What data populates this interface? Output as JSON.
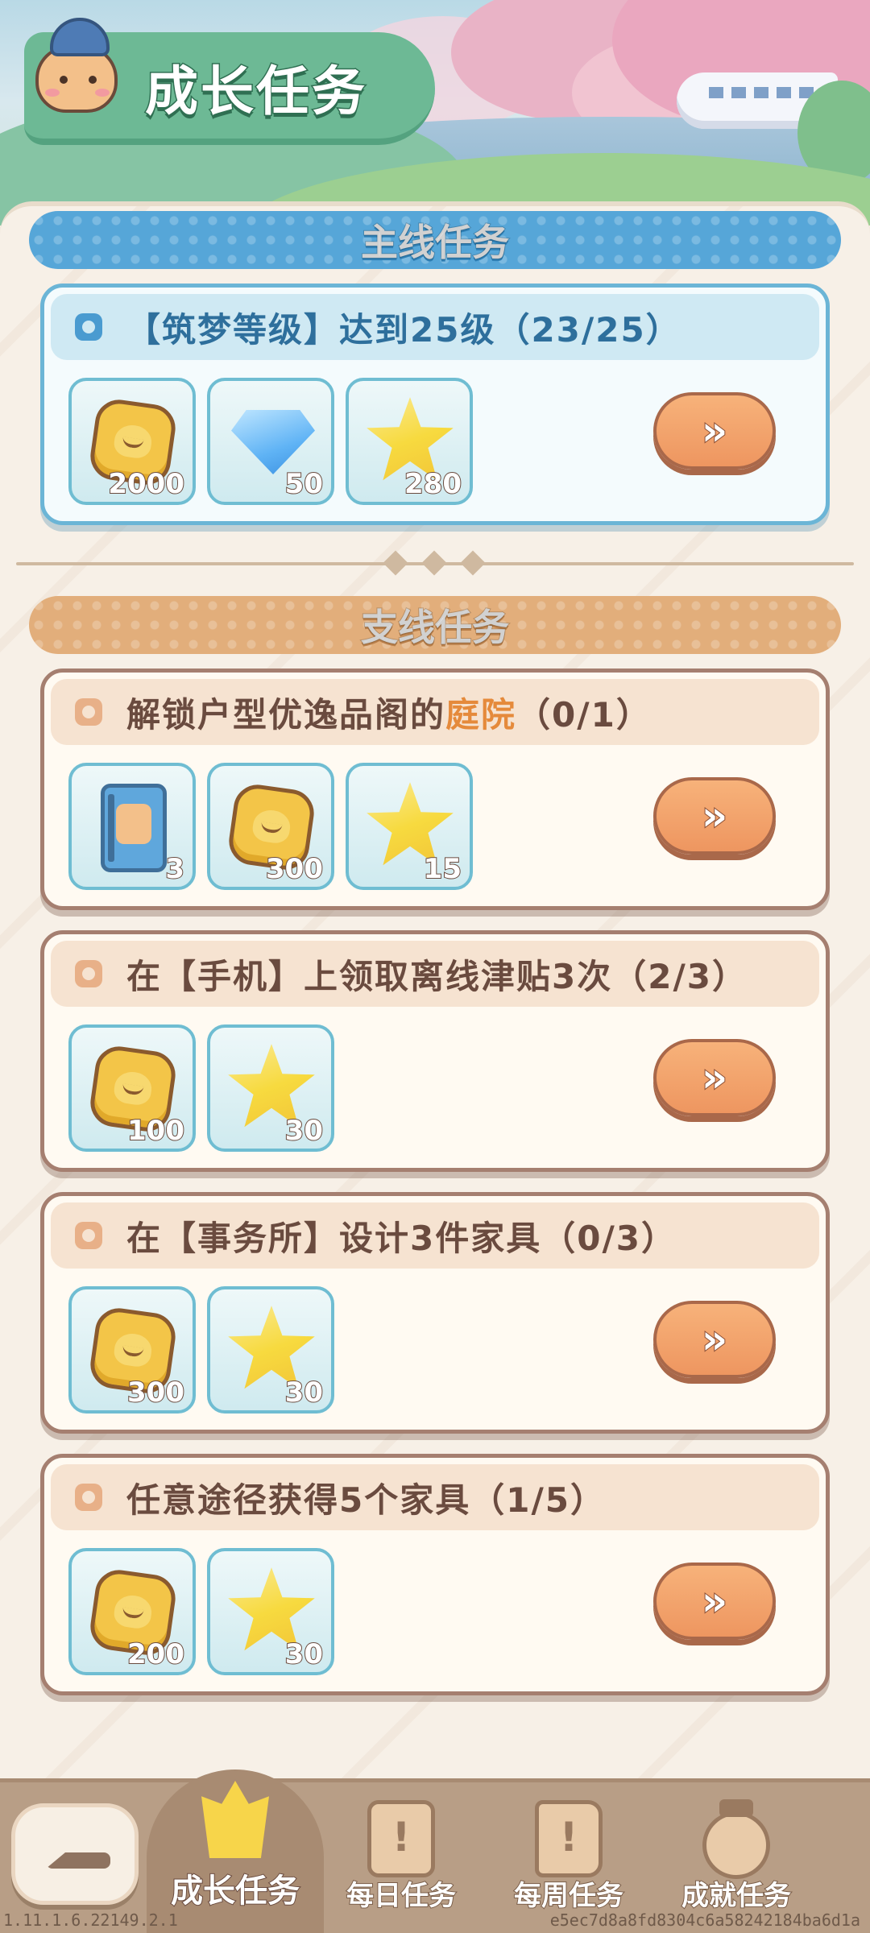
{
  "header": {
    "title": "成长任务"
  },
  "sections": {
    "main_title": "主线任务",
    "side_title": "支线任务"
  },
  "main_task": {
    "text": "【筑梦等级】达到25级（23/25）",
    "rewards": [
      {
        "icon": "coin-icon",
        "qty": "2000"
      },
      {
        "icon": "gem-icon",
        "qty": "50"
      },
      {
        "icon": "star-icon",
        "qty": "280"
      }
    ],
    "go_label": "»"
  },
  "side_tasks": [
    {
      "text_before": "解锁户型优逸品阁的",
      "text_highlight": "庭院",
      "text_after": "（0/1）",
      "rewards": [
        {
          "icon": "book-icon",
          "qty": "3"
        },
        {
          "icon": "coin-icon",
          "qty": "300"
        },
        {
          "icon": "star-icon",
          "qty": "15"
        }
      ],
      "go_label": "»"
    },
    {
      "text": "在【手机】上领取离线津贴3次（2/3）",
      "rewards": [
        {
          "icon": "coin-icon",
          "qty": "100"
        },
        {
          "icon": "star-icon",
          "qty": "30"
        }
      ],
      "go_label": "»"
    },
    {
      "text": "在【事务所】设计3件家具（0/3）",
      "rewards": [
        {
          "icon": "coin-icon",
          "qty": "300"
        },
        {
          "icon": "star-icon",
          "qty": "30"
        }
      ],
      "go_label": "»"
    },
    {
      "text": "任意途径获得5个家具（1/5）",
      "rewards": [
        {
          "icon": "coin-icon",
          "qty": "200"
        },
        {
          "icon": "star-icon",
          "qty": "30"
        }
      ],
      "go_label": "»"
    }
  ],
  "nav": {
    "items": [
      {
        "label": "成长任务",
        "icon": "crown-icon",
        "active": true
      },
      {
        "label": "每日任务",
        "icon": "calendar-icon",
        "active": false
      },
      {
        "label": "每周任务",
        "icon": "book-icon",
        "active": false
      },
      {
        "label": "成就任务",
        "icon": "medal-icon",
        "active": false
      }
    ]
  },
  "footer": {
    "version": "1.11.1.6.22149.2.1",
    "build_hash": "e5ec7d8a8fd8304c6a58242184ba6d1a"
  },
  "colors": {
    "main_accent": "#56a6d8",
    "side_accent": "#e2ae7b",
    "highlight": "#e58a3b",
    "button": "#ee9660"
  }
}
